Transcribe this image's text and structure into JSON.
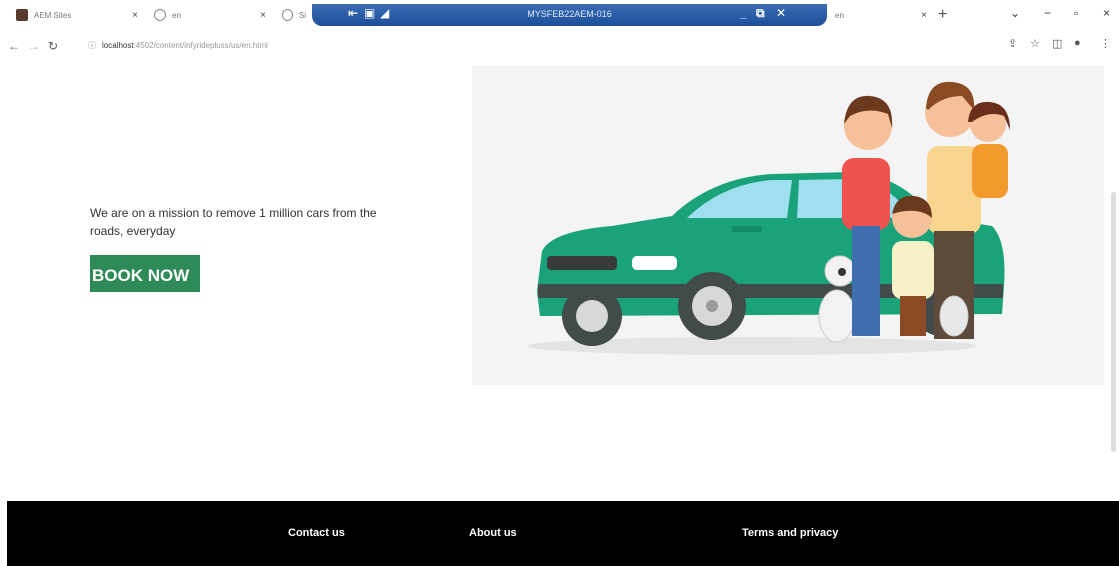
{
  "browser": {
    "tabs": [
      {
        "label": "AEM Sites"
      },
      {
        "label": "en"
      },
      {
        "label": "Si"
      },
      {
        "label": "en"
      }
    ],
    "remote_title": "MYSFEB22AEM-016",
    "url_host": "localhost",
    "url_rest": ":4502/content/infyridepluss/us/en.html"
  },
  "hero": {
    "tagline": "We are on a mission to remove 1 million cars from the roads, everyday",
    "cta_label": "BOOK NOW"
  },
  "footer": {
    "links": [
      "Contact us",
      "About us",
      "Terms and privacy"
    ]
  },
  "colors": {
    "cta": "#2e8b57",
    "car": "#1aa37a",
    "footer_bg": "#000000"
  }
}
